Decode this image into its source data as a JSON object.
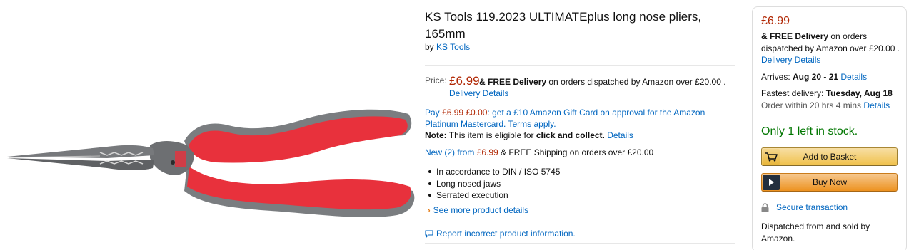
{
  "product": {
    "title": "KS Tools 119.2023 ULTIMATEplus long nose pliers, 165mm",
    "by_prefix": "by",
    "brand": "KS Tools",
    "image_alt": "long nose pliers with red and grey handles"
  },
  "price_block": {
    "label": "Price:",
    "price": "£6.99",
    "amp_free": "& FREE Delivery",
    "delivery_text": " on orders dispatched by Amazon over £20.00 .",
    "delivery_details": "Delivery Details"
  },
  "promo": {
    "pay_prefix": "Pay ",
    "old_price": "£6.99",
    "new_price": " £0.00",
    "offer_text": ": get a £10 Amazon Gift Card on approval for the Amazon Platinum Mastercard. Terms apply.",
    "note_label": "Note:",
    "note_text": " This item is eligible for ",
    "note_bold": "click and collect.",
    "note_details": "Details"
  },
  "offers": {
    "link": "New (2) from",
    "price": " £6.99",
    "shipping": " & FREE Shipping on orders over £20.00"
  },
  "bullets": [
    "In accordance to DIN / ISO 5745",
    "Long nosed jaws",
    "Serrated execution"
  ],
  "see_more": "See more product details",
  "report": "Report incorrect product information.",
  "buybox": {
    "price": "£6.99",
    "free_bold": "& FREE Delivery",
    "free_text": " on orders dispatched by Amazon over £20.00 .",
    "delivery_details": "Delivery Details",
    "arrives_label": "Arrives: ",
    "arrives_date": "Aug 20 - 21",
    "arrives_details": "Details",
    "fastest_label": "Fastest delivery: ",
    "fastest_date": "Tuesday, Aug 18",
    "order_within": "Order within 20 hrs 4 mins",
    "order_details": "Details",
    "stock": "Only 1 left in stock.",
    "add_to_basket": "Add to Basket",
    "buy_now": "Buy Now",
    "secure": "Secure transaction",
    "dispatched": "Dispatched from and sold by Amazon."
  },
  "icons": {
    "cart": "cart-icon",
    "play": "play-icon",
    "lock": "lock-icon",
    "chevron": "chevron-right-icon",
    "comment": "comment-icon"
  },
  "colors": {
    "link": "#0066c0",
    "price": "#b12704",
    "stock": "#007600",
    "basket_button": "#f0c14b",
    "buy_button": "#ed9220"
  }
}
